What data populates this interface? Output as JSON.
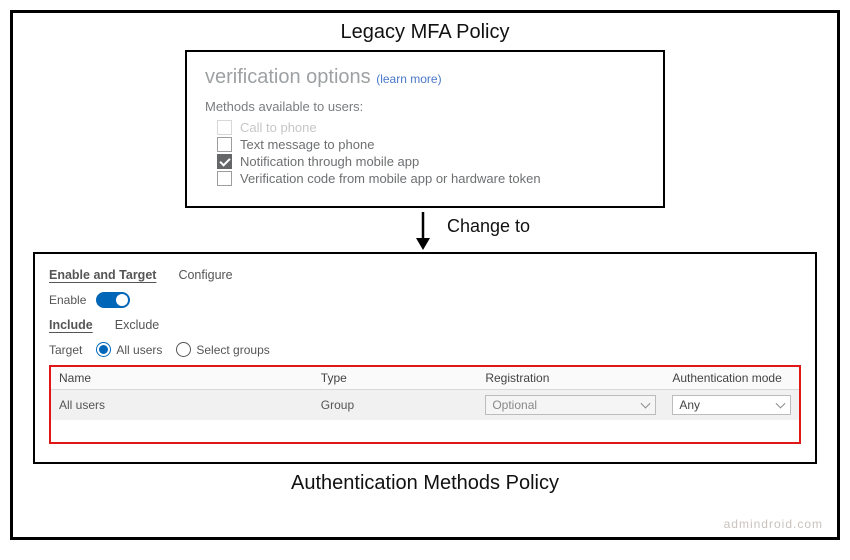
{
  "titles": {
    "top": "Legacy MFA Policy",
    "change_to": "Change to",
    "bottom": "Authentication Methods Policy"
  },
  "legacy": {
    "heading": "verification options",
    "learn_more": "(learn more)",
    "subhead": "Methods available to users:",
    "options": [
      {
        "label": "Call to phone",
        "checked": false,
        "disabled": true
      },
      {
        "label": "Text message to phone",
        "checked": false,
        "disabled": false
      },
      {
        "label": "Notification through mobile app",
        "checked": true,
        "disabled": false
      },
      {
        "label": "Verification code from mobile app or hardware token",
        "checked": false,
        "disabled": false
      }
    ]
  },
  "authmethods": {
    "tabs": {
      "enable_target": "Enable and Target",
      "configure": "Configure",
      "active": "enable_target"
    },
    "enable": {
      "label": "Enable",
      "on": true
    },
    "subtabs": {
      "include": "Include",
      "exclude": "Exclude",
      "active": "include"
    },
    "target": {
      "label": "Target",
      "all_users": "All users",
      "select_groups": "Select groups",
      "selected": "all_users"
    },
    "table": {
      "headers": {
        "name": "Name",
        "type": "Type",
        "registration": "Registration",
        "auth_mode": "Authentication mode"
      },
      "row": {
        "name": "All users",
        "type": "Group",
        "registration": "Optional",
        "auth_mode": "Any"
      }
    }
  },
  "watermark": "admindroid.com"
}
